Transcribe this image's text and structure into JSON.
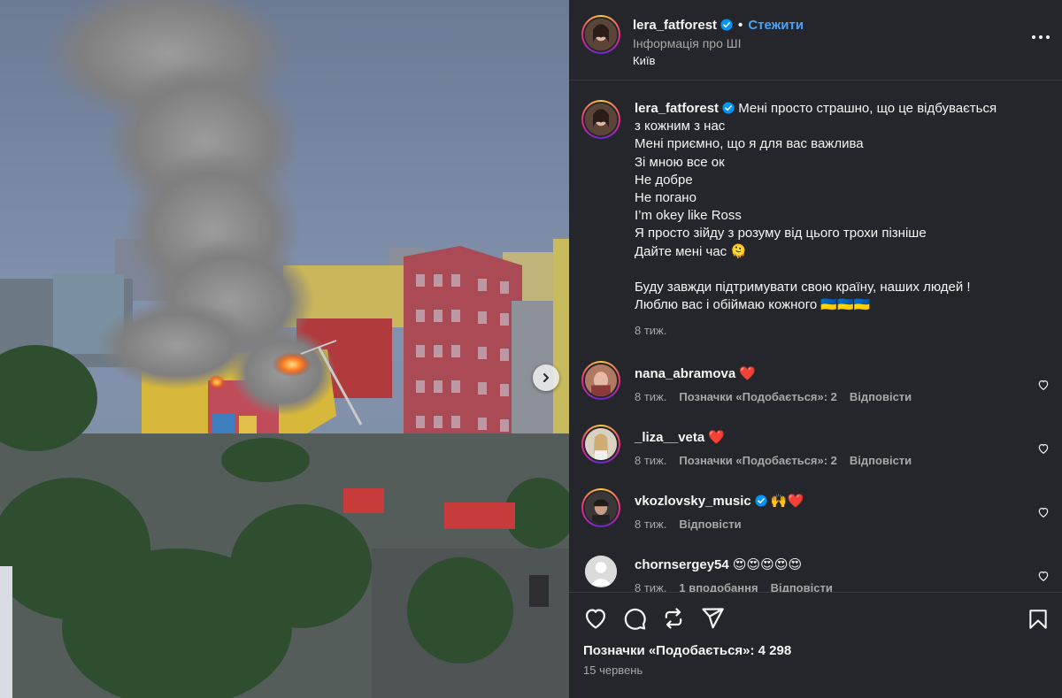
{
  "post": {
    "author": "lera_fatforest",
    "follow_label": "Стежити",
    "dot": "•",
    "ai_info": "Інформація про ШІ",
    "location": "Київ",
    "photo_alt_icon": "next-arrow-icon"
  },
  "caption": {
    "author": "lera_fatforest",
    "lines": [
      "Мені просто страшно, що це відбувається",
      "з кожним з нас",
      "Мені приємно, що я для вас важлива",
      "Зі мною все ок",
      "Не добре",
      "Не погано",
      "I’m okey like Ross",
      "Я просто зійду з розуму від цього трохи пізніше",
      "Дайте мені час 🫠",
      "",
      "Буду завжди підтримувати свою країну, наших людей !",
      "Люблю вас і обіймаю кожного 🇺🇦🇺🇦🇺🇦"
    ],
    "time": "8 тиж."
  },
  "comments": [
    {
      "username": "nana_abramova",
      "text": "❤️",
      "time": "8 тиж.",
      "likes": "Позначки «Подобається»: 2",
      "reply": "Відповісти",
      "verified": false,
      "avatar": "story"
    },
    {
      "username": "_liza__veta",
      "text": "❤️",
      "time": "8 тиж.",
      "likes": "Позначки «Подобається»: 2",
      "reply": "Відповісти",
      "verified": false,
      "avatar": "story"
    },
    {
      "username": "vkozlovsky_music",
      "text": "🙌❤️",
      "time": "8 тиж.",
      "likes": "",
      "reply": "Відповісти",
      "verified": true,
      "avatar": "story"
    },
    {
      "username": "chornsergey54",
      "text": "😍😍😍😍😍",
      "time": "8 тиж.",
      "likes": "1 вподобання",
      "reply": "Відповісти",
      "verified": false,
      "avatar": "default"
    }
  ],
  "footer": {
    "likes": "Позначки «Подобається»: 4 298",
    "date": "15 червень"
  },
  "colors": {
    "panel_bg": "#25262b",
    "follow_blue": "#4aa3f5",
    "verified_blue": "#0095f6",
    "muted": "#a8a8a8",
    "heart_red": "#ed4956"
  }
}
